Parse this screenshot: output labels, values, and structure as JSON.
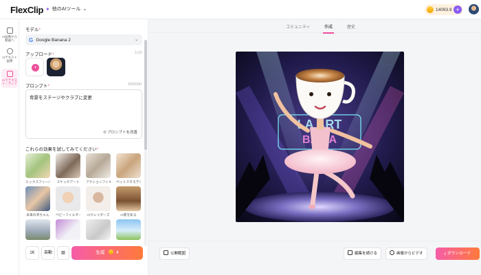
{
  "app": {
    "logo": "FlexClip",
    "tool_select": "他のAIツール",
    "credits": "14093.9"
  },
  "rail": [
    {
      "label": "AI画像から動画へ"
    },
    {
      "label": "AIテキスト画像"
    },
    {
      "label": "AIでテキスト・ディア"
    }
  ],
  "panel": {
    "model_label": "モデル",
    "model_value": "Google Banana 2",
    "upload_label": "アップロード",
    "upload_count": "1/10",
    "prompt_label": "プロンプト",
    "prompt_count": "20/5000",
    "prompt_text": "背景をステージやクラブに変更",
    "prompt_optimize": "プロンプトを改善",
    "effects_label": "これらの効果を試してみてください",
    "effects": [
      {
        "name": "ミックスフィーバー"
      },
      {
        "name": "スケッチアート"
      },
      {
        "name": "アクションフィギュア"
      },
      {
        "name": "ペット３Ｄモデル"
      },
      {
        "name": "未来の赤ちゃん"
      },
      {
        "name": "ベビーフィルター"
      },
      {
        "name": "AIクレイポーズ"
      },
      {
        "name": "AI夏を彩る"
      },
      {
        "name": ""
      },
      {
        "name": ""
      },
      {
        "name": ""
      },
      {
        "name": ""
      }
    ],
    "resolution": "1K",
    "auto": "自動",
    "generate": "生成",
    "generate_cost": "4"
  },
  "tabs": [
    "コミュニティ",
    "作成",
    "歴史"
  ],
  "bottom": {
    "publish": "公開範囲",
    "edit": "編集を続ける",
    "to_video": "画像からビデオ",
    "download": "ダウンロード"
  },
  "canvas_text": "LATTE ART BANANA BOMB"
}
